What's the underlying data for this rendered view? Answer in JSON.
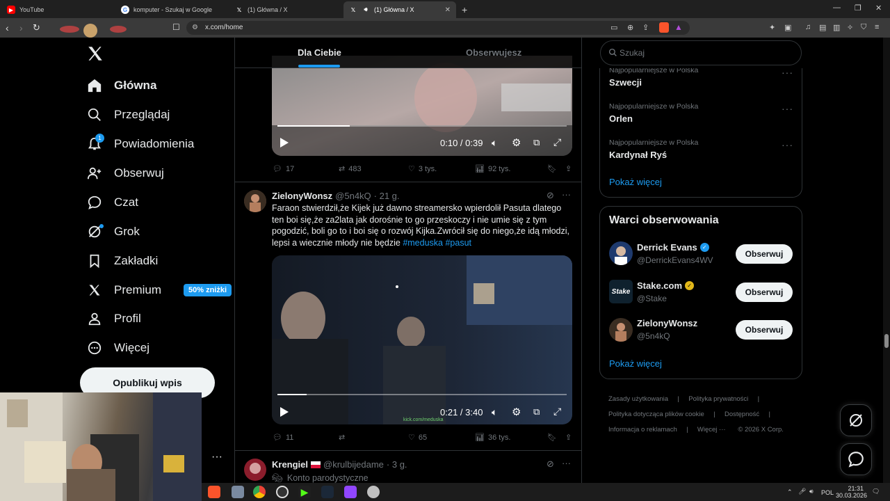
{
  "browser": {
    "tabs": [
      {
        "title": "YouTube",
        "active": false
      },
      {
        "title": "komputer - Szukaj w Google",
        "active": false
      },
      {
        "title": "(1) Główna / X",
        "active": false
      },
      {
        "title": "(1) Główna / X",
        "active": true
      }
    ],
    "url": "x.com/home"
  },
  "nav": {
    "items": [
      {
        "label": "Główna",
        "icon": "home-icon",
        "active": true
      },
      {
        "label": "Przeglądaj",
        "icon": "search-icon"
      },
      {
        "label": "Powiadomienia",
        "icon": "bell-icon",
        "badge": "1"
      },
      {
        "label": "Obserwuj",
        "icon": "person-add-icon"
      },
      {
        "label": "Czat",
        "icon": "chat-icon"
      },
      {
        "label": "Grok",
        "icon": "grok-icon"
      },
      {
        "label": "Zakładki",
        "icon": "bookmark-icon"
      },
      {
        "label": "Premium",
        "icon": "x-logo-icon",
        "badge": "50% zniżki"
      },
      {
        "label": "Profil",
        "icon": "profile-icon"
      },
      {
        "label": "Więcej",
        "icon": "more-circle-icon"
      }
    ],
    "post_button": "Opublikuj wpis",
    "more_dots": "···"
  },
  "feed": {
    "tabs": [
      "Dla Ciebie",
      "Obserwujesz"
    ],
    "tweet1": {
      "video_time": "0:10 / 0:39",
      "video_progress": 0.25,
      "replies": "17",
      "reposts": "483",
      "likes": "3 tys.",
      "views": "92 tys."
    },
    "tweet2": {
      "name": "ZielonyWonsz",
      "handle": "@5n4kQ",
      "time": "· 21 g.",
      "text": "Faraon stwierdził,że Kijek już dawno streamersko wpierdolił Pasuta dlatego ten boi się,że za2lata jak dorośnie to go przeskoczy i nie umie się z tym pogodzić, boli go to i boi się o rozwój Kijka.Zwrócił się do niego,że idą młodzi, lepsi a wiecznie młody nie będzie",
      "hashtags": "#meduska #pasut",
      "video_time": "0:21 / 3:40",
      "video_progress": 0.1,
      "watermark": "kick.com/meduska",
      "replies": "11",
      "reposts": "",
      "likes": "65",
      "views": "36 tys."
    },
    "tweet3": {
      "name": "Krengiel",
      "handle": "@krulbijedame",
      "time": "· 3 g.",
      "label": "Konto parodystyczne"
    }
  },
  "sidebar": {
    "search_placeholder": "Szukaj",
    "trends": [
      {
        "category": "Najpopularniejsze w Polska",
        "name": "Szwecji"
      },
      {
        "category": "Najpopularniejsze w Polska",
        "name": "Orlen"
      },
      {
        "category": "Najpopularniejsze w Polska",
        "name": "Kardynał Ryś"
      }
    ],
    "trends_show_more": "Pokaż więcej",
    "who_to_follow_title": "Warci obserwowania",
    "who_to_follow": [
      {
        "name": "Derrick Evans",
        "handle": "@DerrickEvans4WV",
        "verified": "blue"
      },
      {
        "name": "Stake.com",
        "handle": "@Stake",
        "verified": "gold"
      },
      {
        "name": "ZielonyWonsz",
        "handle": "@5n4kQ",
        "verified": ""
      }
    ],
    "follow_label": "Obserwuj",
    "wto_show_more": "Pokaż więcej",
    "footer": [
      "Zasady użytkowania",
      "|",
      "Polityka prywatności",
      "|",
      "Polityka dotycząca plików cookie",
      "|",
      "Dostępność",
      "|",
      "Informacja o reklamach",
      "|",
      "Więcej ···",
      "© 2026 X Corp."
    ]
  },
  "taskbar": {
    "lang": "POL",
    "time": "21:31",
    "date": "30.03.2026"
  },
  "colors": {
    "accent": "#1d9bf0",
    "background": "#000000",
    "border": "#2f3336",
    "muted": "#71767b"
  }
}
